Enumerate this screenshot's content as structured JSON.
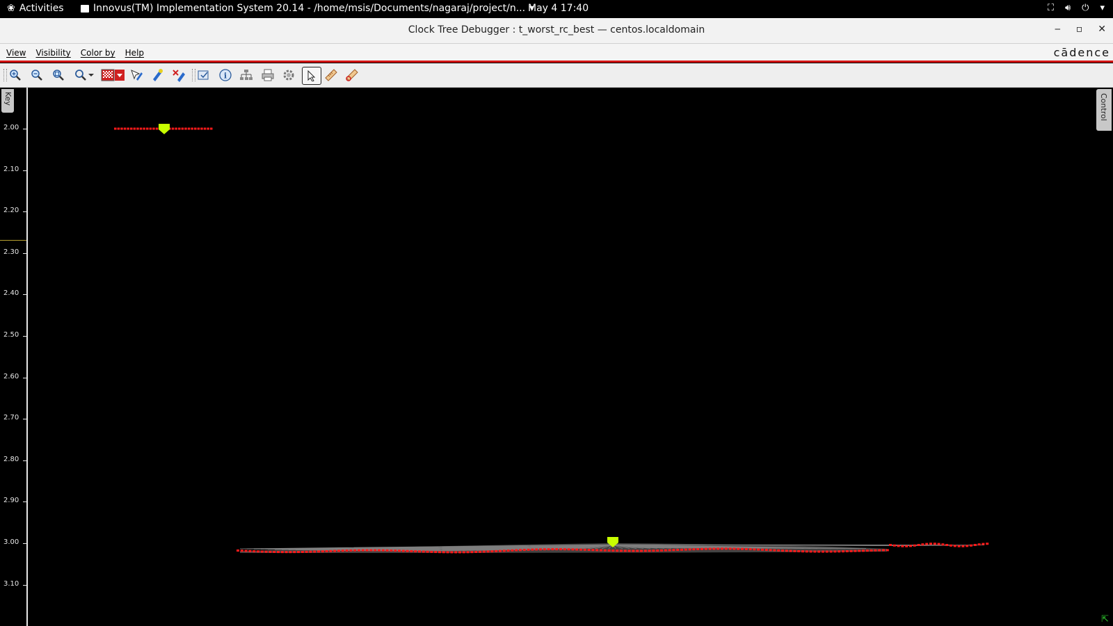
{
  "topbar": {
    "activities": "Activities",
    "app_title": "Innovus(TM) Implementation System 20.14 - /home/msis/Documents/nagaraj/project/n...",
    "clock": "May 4  17:40"
  },
  "window": {
    "title": "Clock Tree Debugger : t_worst_rc_best — centos.localdomain"
  },
  "menu": {
    "items": [
      "View",
      "Visibility",
      "Color by",
      "Help"
    ],
    "brand": "cādence"
  },
  "toolbar": {
    "icons": [
      "zoom-in-icon",
      "zoom-out-icon",
      "zoom-fit-icon",
      "refresh-icon",
      "color-pattern-icon",
      "highlight-icon",
      "dehighlight-icon",
      "clear-highlight-icon",
      "select-window-icon",
      "info-icon",
      "hierarchy-icon",
      "print-icon",
      "settings-icon",
      "pointer-icon",
      "ruler-icon",
      "measure-icon"
    ]
  },
  "side_tabs": {
    "left": "Key",
    "right": "Control"
  },
  "colors": {
    "sink": "#ff1a1a",
    "root_marker": "#c8ff00",
    "wire": "#9a9a9a",
    "axis": "#e8e8e8",
    "accent_red": "#d21414"
  },
  "chart_data": {
    "type": "scatter",
    "y_ticks": [
      "2.00",
      "2.10",
      "2.20",
      "2.30",
      "2.40",
      "2.50",
      "2.60",
      "2.70",
      "2.80",
      "2.90",
      "3.00",
      "3.10"
    ],
    "ylim": [
      2.0,
      3.1
    ],
    "y_inverted": true,
    "series": [
      {
        "root_y": 2.0,
        "points_y": [
          2.0
        ]
      },
      {
        "root_y": 3.0,
        "points_y": [
          3.02,
          3.0
        ]
      }
    ]
  }
}
